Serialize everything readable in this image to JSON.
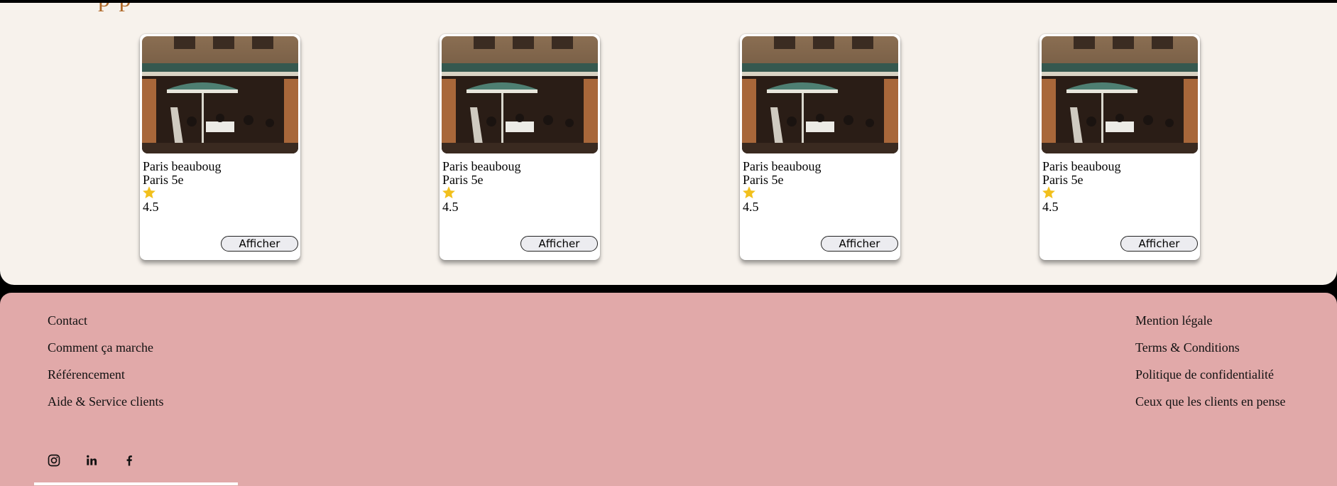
{
  "heading_fragment": "p p",
  "cards": [
    {
      "name": "Paris beauboug",
      "area": "Paris 5e",
      "rating": "4.5",
      "button": "Afficher",
      "star_icon": "star-icon"
    },
    {
      "name": "Paris beauboug",
      "area": "Paris 5e",
      "rating": "4.5",
      "button": "Afficher",
      "star_icon": "star-icon"
    },
    {
      "name": "Paris beauboug",
      "area": "Paris 5e",
      "rating": "4.5",
      "button": "Afficher",
      "star_icon": "star-icon"
    },
    {
      "name": "Paris beauboug",
      "area": "Paris 5e",
      "rating": "4.5",
      "button": "Afficher",
      "star_icon": "star-icon"
    }
  ],
  "footer": {
    "left_links": [
      "Contact",
      "Comment ça marche",
      "Référencement",
      "Aide & Service clients"
    ],
    "right_links": [
      "Mention légale",
      "Terms & Conditions",
      "Politique de confidentialité",
      "Ceux que les clients en pense"
    ],
    "social_icons": [
      "instagram-icon",
      "linkedin-icon",
      "facebook-icon"
    ]
  },
  "colors": {
    "top_background": "#f7f2ec",
    "footer_background": "#e1a9a9",
    "star": "#f2c01c",
    "accent_heading": "#b06a2a"
  }
}
